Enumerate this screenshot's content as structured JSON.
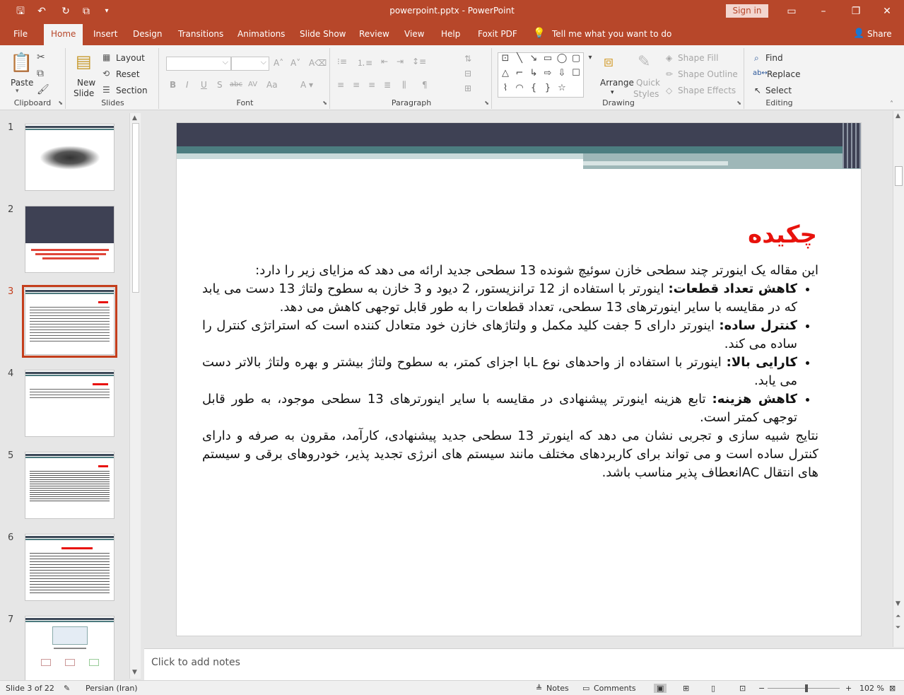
{
  "window": {
    "title": "powerpoint.pptx  -  PowerPoint",
    "sign_in": "Sign in"
  },
  "tabs": [
    "File",
    "Home",
    "Insert",
    "Design",
    "Transitions",
    "Animations",
    "Slide Show",
    "Review",
    "View",
    "Help",
    "Foxit PDF"
  ],
  "active_tab": "Home",
  "tell_me": "Tell me what you want to do",
  "share": "Share",
  "ribbon": {
    "clipboard": {
      "label": "Clipboard",
      "paste": "Paste"
    },
    "slides": {
      "label": "Slides",
      "new_slide": "New",
      "new_slide2": "Slide",
      "layout": "Layout",
      "reset": "Reset",
      "section": "Section"
    },
    "font": {
      "label": "Font"
    },
    "paragraph": {
      "label": "Paragraph"
    },
    "drawing": {
      "label": "Drawing",
      "arrange": "Arrange",
      "quick_styles": "Quick",
      "quick_styles2": "Styles",
      "shape_fill": "Shape Fill",
      "shape_outline": "Shape Outline",
      "shape_effects": "Shape Effects"
    },
    "editing": {
      "label": "Editing",
      "find": "Find",
      "replace": "Replace",
      "select": "Select"
    }
  },
  "thumbnails": {
    "numbers": [
      "1",
      "2",
      "3",
      "4",
      "5",
      "6",
      "7"
    ],
    "selected": "3"
  },
  "slide": {
    "title": "چکیده",
    "intro": "این مقاله یک اینورتر چند سطحی خازن سوئیچ شونده 13 سطحی جدید ارائه می دهد که مزایای زیر را دارد:",
    "bullets": [
      {
        "head": "کاهش تعداد قطعات:",
        "text": " اینورتر با استفاده از 12 ترانزیستور، 2 دیود و 3 خازن به سطوح ولتاژ 13 دست می یابد که در مقایسه با سایر اینورترهای 13 سطحی، تعداد قطعات را به طور قابل توجهی کاهش می دهد."
      },
      {
        "head": "کنترل ساده:",
        "text": " اینورتر دارای 5 جفت کلید مکمل و ولتاژهای خازن خود متعادل کننده است که استراتژی کنترل را ساده می کند."
      },
      {
        "head": "کارایی بالا:",
        "text": " اینورتر با استفاده از واحدهای نوع   Lبا اجزای کمتر، به سطوح ولتاژ بیشتر و بهره ولتاژ بالاتر دست می یابد."
      },
      {
        "head": "کاهش هزینه:",
        "text": " تابع هزینه اینورتر پیشنهادی در مقایسه با سایر اینورترهای 13 سطحی موجود، به طور قابل توجهی کمتر است."
      }
    ],
    "conclusion": "نتایج شبیه سازی و تجربی نشان می دهد که اینورتر 13 سطحی جدید پیشنهادی، کارآمد، مقرون به صرفه و دارای کنترل ساده است و می تواند برای کاربردهای مختلف مانند سیستم های انرژی تجدید پذیر، خودروهای برقی و سیستم های انتقال  ACانعطاف پذیر مناسب باشد."
  },
  "notes_placeholder": "Click to add notes",
  "status": {
    "slide_info": "Slide 3 of 22",
    "language": "Persian (Iran)",
    "notes": "Notes",
    "comments": "Comments",
    "zoom_minus": "−",
    "zoom_plus": "+",
    "zoom": "102 %"
  },
  "colors": {
    "accent": "#b7472a",
    "title_red": "#e8120c",
    "slide_dark": "#3e4154",
    "slide_teal": "#4c7d80"
  }
}
